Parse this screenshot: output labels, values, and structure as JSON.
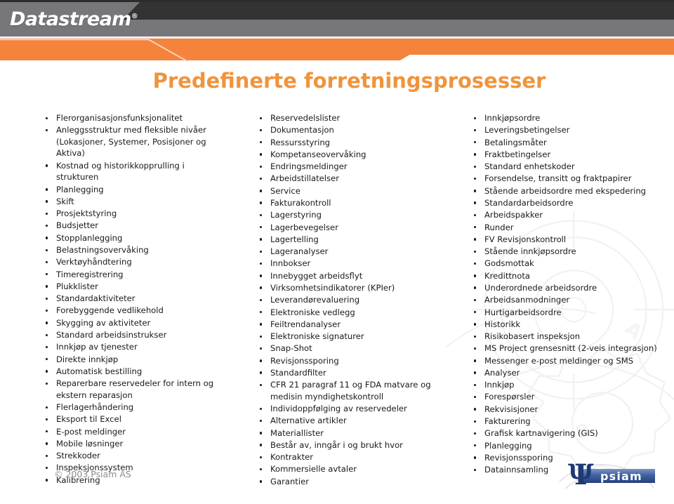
{
  "header": {
    "brand": "Datastream",
    "brand_registered_mark": "®",
    "colors": {
      "dark_bar": "#333333",
      "gray_bar": "#77777b",
      "orange_bar": "#F5833C",
      "title_orange": "#F0943C"
    }
  },
  "title": "Predefinerte forretningsprosesser",
  "columns": [
    {
      "id": "column-1",
      "items": [
        "Flerorganisasjonsfunksjonalitet",
        "Anleggsstruktur med fleksible nivåer (Lokasjoner, Systemer, Posisjoner og Aktiva)",
        "Kostnad og historikkopprulling i strukturen",
        "Planlegging",
        "Skift",
        "Prosjektstyring",
        "Budsjetter",
        "Stopplanlegging",
        "Belastningsovervåking",
        "Verktøyhåndtering",
        "Timeregistrering",
        "Plukklister",
        "Standardaktiviteter",
        "Forebyggende vedlikehold",
        "Skygging av aktiviteter",
        "Standard arbeidsinstrukser",
        "Innkjøp av tjenester",
        "Direkte innkjøp",
        "Automatisk bestilling",
        "Reparerbare reservedeler for intern og ekstern reparasjon",
        "Flerlagerhåndering",
        "Eksport til Excel",
        "E-post meldinger",
        "Mobile løsninger",
        "Strekkoder",
        "Inspeksjonssystem",
        "Kalibrering"
      ]
    },
    {
      "id": "column-2",
      "items": [
        "Reservedelslister",
        "Dokumentasjon",
        "Ressursstyring",
        "Kompetanseovervåking",
        "Endringsmeldinger",
        "Arbeidstillatelser",
        "Service",
        "Fakturakontroll",
        "Lagerstyring",
        "Lagerbevegelser",
        "Lagertelling",
        "Lageranalyser",
        "Innbokser",
        "Innebygget arbeidsflyt",
        "Virksomhetsindikatorer (KPIer)",
        "Leverandørevaluering",
        "Elektroniske vedlegg",
        "Feiltrendanalyser",
        "Elektroniske signaturer",
        "Snap-Shot",
        "Revisjonssporing",
        "Standardfilter",
        "CFR 21 paragraf 11 og FDA matvare og medisin myndighetskontroll",
        "Individoppfølging av reservedeler",
        "Alternative artikler",
        "Materiallister",
        "Består av, inngår i og brukt hvor",
        "Kontrakter",
        "Kommersielle avtaler",
        "Garantier"
      ]
    },
    {
      "id": "column-3",
      "items": [
        "Innkjøpsordre",
        "Leveringsbetingelser",
        "Betalingsmåter",
        "Fraktbetingelser",
        "Standard enhetskoder",
        "Forsendelse, transitt og fraktpapirer",
        "Stående arbeidsordre med ekspedering",
        "Standardarbeidsordre",
        "Arbeidspakker",
        "Runder",
        "FV Revisjonskontroll",
        "Stående innkjøpsordre",
        "Godsmottak",
        "Kredittnota",
        "Underordnede arbeidsordre",
        "Arbeidsanmodninger",
        "Hurtigarbeidsordre",
        "Historikk",
        "Risikobasert inspeksjon",
        "MS Project grensesnitt (2-veis integrasjon)",
        "Messenger e-post meldinger og SMS",
        "Analyser",
        "Innkjøp",
        "Forespørsler",
        "Rekvisisjoner",
        "Fakturering",
        "Grafisk kartnavigering (GIS)",
        "Planlegging",
        "Revisjonssporing",
        "Datainnsamling"
      ]
    }
  ],
  "copyright": "© 2003 Psiam AS",
  "psiam_logo": {
    "symbol": "Ψ",
    "wordmark": "psiam",
    "color": "#2b4a86"
  }
}
